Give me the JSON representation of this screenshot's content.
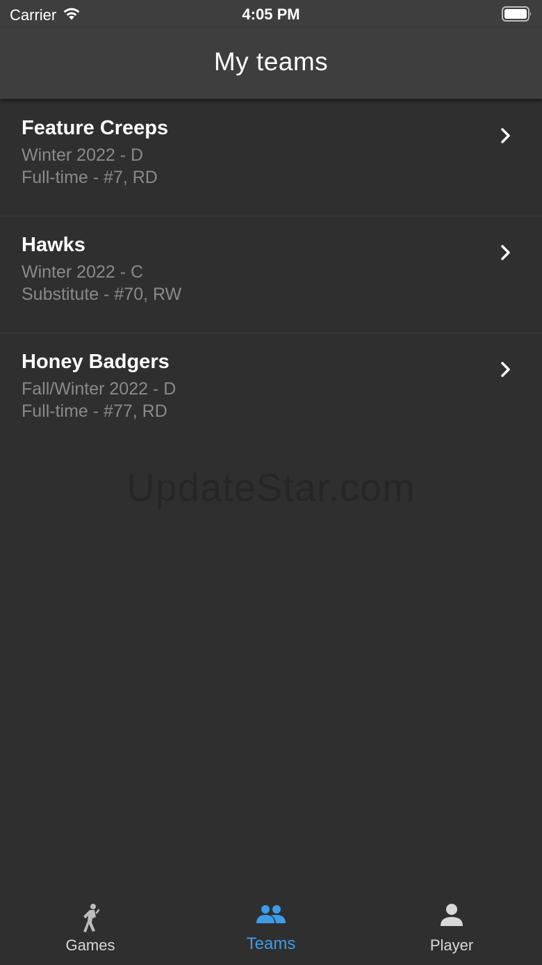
{
  "status": {
    "carrier": "Carrier",
    "time": "4:05 PM",
    "wifi_icon": "wifi-icon",
    "battery_icon": "battery-full-icon"
  },
  "header": {
    "title": "My teams"
  },
  "teams": [
    {
      "name": "Feature Creeps",
      "season": "Winter 2022 - D",
      "role": "Full-time - #7, RD"
    },
    {
      "name": "Hawks",
      "season": "Winter 2022 - C",
      "role": "Substitute - #70, RW"
    },
    {
      "name": "Honey Badgers",
      "season": "Fall/Winter 2022 - D",
      "role": "Full-time - #77, RD"
    }
  ],
  "watermark": "UpdateStar.com",
  "tabs": [
    {
      "label": "Games",
      "icon": "hockey-player-icon",
      "active": false
    },
    {
      "label": "Teams",
      "icon": "group-icon",
      "active": true
    },
    {
      "label": "Player",
      "icon": "person-icon",
      "active": false
    }
  ],
  "colors": {
    "background": "#2f2f2f",
    "header": "#3e3e3e",
    "accent": "#3f9be8",
    "secondary_text": "#8a8a8a"
  }
}
